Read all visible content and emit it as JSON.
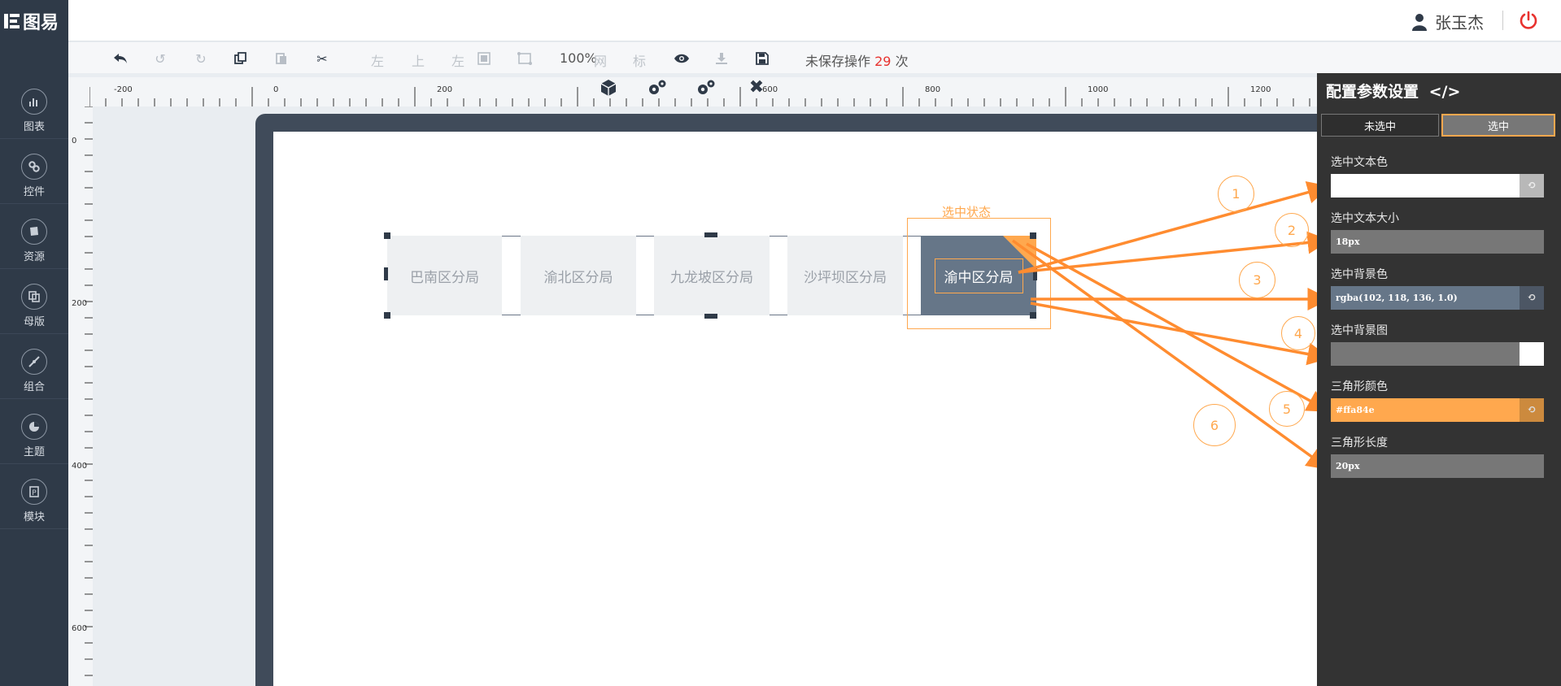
{
  "header": {
    "logo_text": "图易",
    "user_name": "张玉杰"
  },
  "sidebar": {
    "items": [
      {
        "label": "图表",
        "icon": "chart-icon"
      },
      {
        "label": "控件",
        "icon": "link-icon"
      },
      {
        "label": "资源",
        "icon": "book-icon"
      },
      {
        "label": "母版",
        "icon": "copy-icon"
      },
      {
        "label": "组合",
        "icon": "compress-icon"
      },
      {
        "label": "主题",
        "icon": "pie-icon"
      },
      {
        "label": "模块",
        "icon": "module-icon"
      }
    ]
  },
  "toolbar": {
    "align_left": "左",
    "align_top": "上",
    "align_left2": "左",
    "zoom": "100%",
    "grid": "网",
    "mark": "标",
    "unsaved_prefix": "未保存操作",
    "unsaved_count": "29",
    "unsaved_suffix": "次"
  },
  "ruler": {
    "h_labels": [
      "-200",
      "0",
      "200",
      "600",
      "800",
      "1000",
      "1200"
    ],
    "v_labels": [
      "0",
      "200",
      "400",
      "600"
    ]
  },
  "canvas": {
    "tabs": [
      "巴南区分局",
      "渝北区分局",
      "九龙坡区分局",
      "沙坪坝区分局",
      "渝中区分局"
    ],
    "state_label": "选中状态",
    "annotations": [
      "1",
      "2",
      "3",
      "4",
      "5",
      "6"
    ]
  },
  "panel": {
    "title": "配置参数设置",
    "code_icon": "</>",
    "seg_unselected": "未选中",
    "seg_selected": "选中",
    "fields": {
      "text_color_label": "选中文本色",
      "text_size_label": "选中文本大小",
      "text_size_value": "18px",
      "bg_color_label": "选中背景色",
      "bg_color_value": "rgba(102, 118, 136, 1.0)",
      "bg_image_label": "选中背景图",
      "triangle_color_label": "三角形颜色",
      "triangle_color_value": "#ffa84e",
      "triangle_length_label": "三角形长度",
      "triangle_length_value": "20px"
    }
  },
  "colors": {
    "accent": "#ffa84e",
    "dark": "#2f3a48",
    "active_tab": "#667688",
    "danger": "#e8322f"
  }
}
